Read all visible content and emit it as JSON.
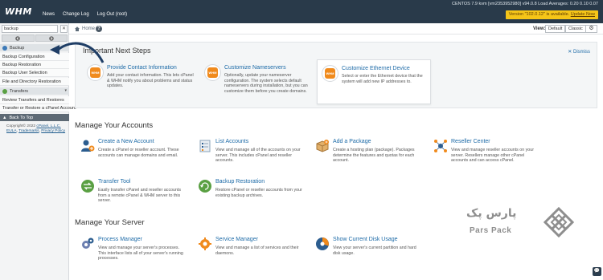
{
  "topbar": {
    "logo": "WHM",
    "nav": [
      "News",
      "Change Log",
      "Log Out (root)"
    ],
    "sysinfo": "CENTOS 7.9 kvm [vm2353952980]   v94.0.8   Load Averages: 0.20 0.10 0.07",
    "update_text": "Version \"102.0.12\" is available.",
    "update_link": "Update Now"
  },
  "sidebar": {
    "search_value": "backup",
    "clear_label": "✕",
    "categories": [
      {
        "label": "Backup",
        "items": [
          "Backup Configuration",
          "Backup Restoration",
          "Backup User Selection",
          "File and Directory Restoration"
        ]
      },
      {
        "label": "Transfers",
        "items": [
          "Review Transfers and Restores",
          "Transfer or Restore a cPanel Account"
        ]
      }
    ],
    "back_to_top": "Back To Top",
    "copyright": "Copyright© 2022",
    "copyright_link": "cPanel, L.L.C.",
    "links": [
      "EULA",
      "Trademarks",
      "Privacy Policy"
    ]
  },
  "crumb": {
    "home": "Home",
    "help": "?",
    "view_label": "View:",
    "view_default": "Default",
    "view_classic": "Classic"
  },
  "next_steps": {
    "title": "Important Next Steps",
    "dismiss": "Dismiss",
    "cards": [
      {
        "title": "Provide Contact Information",
        "desc": "Add your contact information. This lets cPanel & WHM notify you about problems and status updates.",
        "icon": "WHM"
      },
      {
        "title": "Customize Nameservers",
        "desc": "Optionally, update your nameserver configuration. The system selects default nameservers during installation, but you can customize them before you create domains.",
        "icon": "WHM"
      },
      {
        "title": "Customize Ethernet Device",
        "desc": "Select or enter the Ethernet device that the system will add new IP addresses to.",
        "icon": "WHM"
      }
    ]
  },
  "accounts": {
    "title": "Manage Your Accounts",
    "tiles": [
      {
        "title": "Create a New Account",
        "desc": "Create a cPanel or reseller account. These accounts can manage domains and email.",
        "icon": "user-add-icon"
      },
      {
        "title": "List Accounts",
        "desc": "View and manage all of the accounts on your server. This includes cPanel and reseller accounts.",
        "icon": "list-accounts-icon"
      },
      {
        "title": "Add a Package",
        "desc": "Create a hosting plan (package). Packages determine the features and quotas for each account.",
        "icon": "add-package-icon"
      },
      {
        "title": "Reseller Center",
        "desc": "View and manage reseller accounts on your server. Resellers manage other cPanel accounts and can access cPanel.",
        "icon": "reseller-icon"
      },
      {
        "title": "Transfer Tool",
        "desc": "Easily transfer cPanel and reseller accounts from a remote cPanel & WHM server to this server.",
        "icon": "transfer-icon"
      },
      {
        "title": "Backup Restoration",
        "desc": "Restore cPanel or reseller accounts from your existing backup archives.",
        "icon": "backup-restore-icon"
      }
    ]
  },
  "server": {
    "title": "Manage Your Server",
    "tiles": [
      {
        "title": "Process Manager",
        "desc": "View and manage your server's processes. This interface lists all of your server's running processes.",
        "icon": "process-manager-icon"
      },
      {
        "title": "Service Manager",
        "desc": "View and manage a list of services and their daemons.",
        "icon": "service-manager-icon"
      },
      {
        "title": "Show Current Disk Usage",
        "desc": "View your server's current partition and hard disk usage.",
        "icon": "disk-usage-icon"
      }
    ]
  },
  "watermark": {
    "fa": "پارس پک",
    "en": "Pars Pack"
  },
  "colors": {
    "topbar": "#293a4a",
    "link": "#1c6aa7",
    "update": "#f5c518",
    "orange": "#f08a1c"
  }
}
